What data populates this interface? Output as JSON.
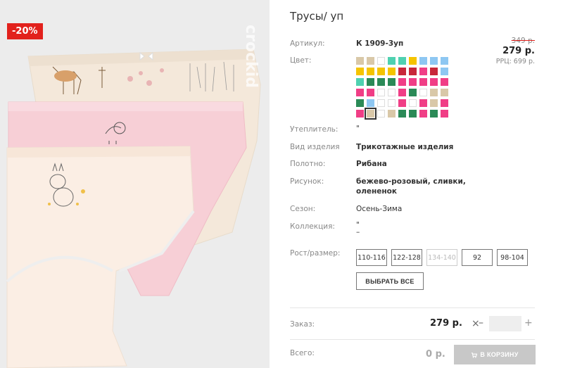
{
  "product": {
    "title": "Трусы/ уп",
    "discount_badge": "-20%",
    "watermark": "crockid"
  },
  "attributes": {
    "article_label": "Артикул:",
    "article_value": "К 1909-3уп",
    "color_label": "Цвет:",
    "insulation_label": "Утеплитель:",
    "insulation_value": "\"",
    "type_label": "Вид изделия",
    "type_value": "Трикотажные изделия",
    "fabric_label": "Полотно:",
    "fabric_value": "Рибана",
    "pattern_label": "Рисунок:",
    "pattern_value_line1": "бежево-розовый, сливки,",
    "pattern_value_line2": "олененок",
    "season_label": "Сезон:",
    "season_value": "Осень-Зима",
    "collection_label": "Коллекция:",
    "collection_value_line1": "\"",
    "collection_value_line2": "–",
    "size_label": "Рост/размер:"
  },
  "price": {
    "old": "349 р.",
    "current": "279 р.",
    "rrp": "РРЦ: 699 р."
  },
  "swatches": [
    "#d9c8a8",
    "#d9c8a8",
    "#ffffff",
    "#4fd1b0",
    "#4fd1b0",
    "#f5c400",
    "#8ec7f2",
    "#8ec7f2",
    "#8ec7f2",
    "#f5c400",
    "#f5c400",
    "#f5c400",
    "#f5c400",
    "#c8273a",
    "#c8273a",
    "#f03e86",
    "#c8273a",
    "#8ec7f2",
    "#4fd1b0",
    "#2b8a57",
    "#2b8a57",
    "#2b8a57",
    "#f03e86",
    "#f03e86",
    "#f03e86",
    "#f03e86",
    "#f03e86",
    "#f03e86",
    "#f03e86",
    "#ffffff",
    "#ffffff",
    "#f03e86",
    "#2b8a57",
    "#ffffff",
    "#d9c8a8",
    "#d9c8a8",
    "#2b8a57",
    "#8ec7f2",
    "#ffffff",
    "#ffffff",
    "#f03e86",
    "#ffffff",
    "#f03e86",
    "#d9c8a8",
    "#f03e86",
    "#f03e86",
    "#d9c8a8",
    "#ffffff",
    "#d9c8a8",
    "#2b8a57",
    "#2b8a57",
    "#f03e86",
    "#2b8a57",
    "#f03e86"
  ],
  "selected_swatch_index": 46,
  "sizes": [
    {
      "label": "110-116",
      "available": true
    },
    {
      "label": "122-128",
      "available": true
    },
    {
      "label": "134-140",
      "available": false
    },
    {
      "label": "92",
      "available": true
    },
    {
      "label": "98-104",
      "available": true
    }
  ],
  "select_all_label": "ВЫБРАТЬ ВСЕ",
  "order": {
    "label": "Заказ:",
    "price": "279 р.",
    "times": "×",
    "minus": "–",
    "plus": "+",
    "quantity": ""
  },
  "total": {
    "label": "Всего:",
    "value": "0 р.",
    "cart_label": "В КОРЗИНУ"
  }
}
